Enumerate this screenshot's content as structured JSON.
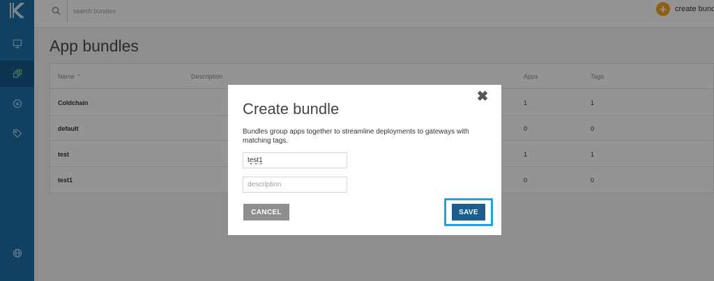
{
  "search": {
    "placeholder": "search bundles"
  },
  "header": {
    "create_label": "create bundle",
    "create_icon": "plus-circle-icon"
  },
  "page": {
    "title": "App bundles"
  },
  "table": {
    "columns": [
      "Name",
      "Description",
      "Apps",
      "Tags"
    ],
    "sort_indicator": "^",
    "rows": [
      {
        "name": "Coldchain",
        "description": "",
        "apps": "1",
        "tags": "1"
      },
      {
        "name": "default",
        "description": "",
        "apps": "0",
        "tags": "0"
      },
      {
        "name": "test",
        "description": "",
        "apps": "1",
        "tags": "1"
      },
      {
        "name": "test1",
        "description": "",
        "apps": "0",
        "tags": "0"
      }
    ]
  },
  "sidebar": {
    "items": [
      {
        "icon": "gateway-icon"
      },
      {
        "icon": "bundles-icon",
        "active": true
      },
      {
        "icon": "deploy-icon"
      },
      {
        "icon": "tag-icon"
      },
      {
        "icon": "globe-icon"
      }
    ]
  },
  "modal": {
    "title": "Create bundle",
    "description": "Bundles group apps together to streamline deployments to gateways with matching tags.",
    "name_value": "test1",
    "description_placeholder": "description",
    "cancel_label": "CANCEL",
    "save_label": "SAVE",
    "close_glyph": "✖"
  },
  "colors": {
    "sidebar": "#1f6fa8",
    "accent_orange": "#f6a623",
    "save_button": "#1b5e8f",
    "highlight": "#1fa3e0"
  }
}
